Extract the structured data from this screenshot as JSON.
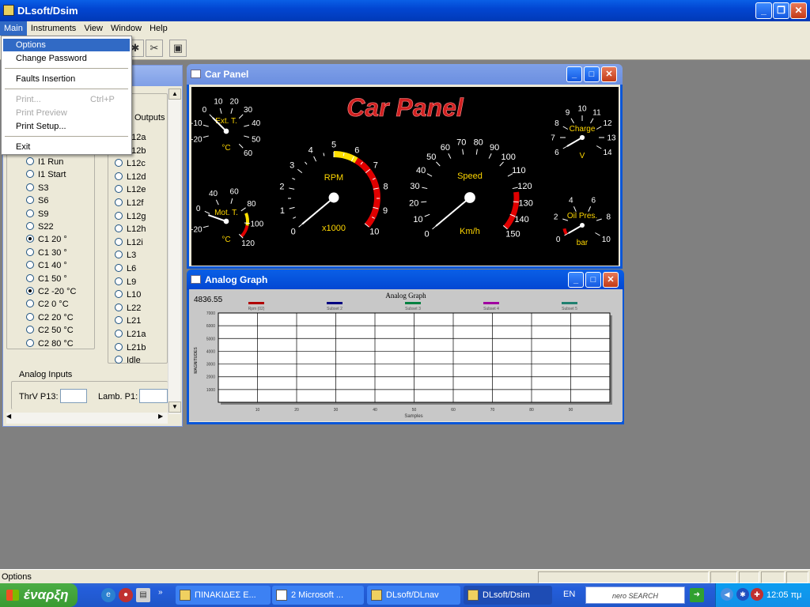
{
  "app": {
    "title": "DLsoft/Dsim"
  },
  "menubar": [
    "Main",
    "Instruments",
    "View",
    "Window",
    "Help"
  ],
  "main_menu": {
    "items": [
      {
        "label": "Options",
        "state": "selected"
      },
      {
        "label": "Change Password",
        "state": "normal"
      },
      {
        "label": "Faults Insertion",
        "state": "normal"
      },
      {
        "label": "Print...",
        "shortcut": "Ctrl+P",
        "state": "disabled"
      },
      {
        "label": "Print Preview",
        "state": "disabled"
      },
      {
        "label": "Print Setup...",
        "state": "normal"
      },
      {
        "label": "Exit",
        "state": "normal"
      }
    ]
  },
  "left_panel": {
    "inputs_col": [
      "I1 Run",
      "I1 Start",
      "S3",
      "S6",
      "S9",
      "S22",
      "C1  20 °",
      "C1  30 °",
      "C1  40 °",
      "C1  50 °",
      "C2 -20 °C",
      "C2   0 °C",
      "C2  20 °C",
      "C2  50 °C",
      "C2  80 °C"
    ],
    "inputs_checked": [
      6,
      10
    ],
    "outputs_label": "Outputs",
    "outputs_col": [
      "L12a",
      "L12b",
      "L12c",
      "L12d",
      "L12e",
      "L12f",
      "L12g",
      "L12h",
      "L12i",
      "L3",
      "L6",
      "L9",
      "L10",
      "L22",
      "L21",
      "L21a",
      "L21b",
      "Idle"
    ],
    "analog_inputs_label": "Analog Inputs",
    "thrv_label": "ThrV P13:",
    "lamb_label": "Lamb. P1:"
  },
  "car_panel": {
    "title": "Car Panel",
    "banner": "Car Panel",
    "ext_t": {
      "label": "Ext. T.",
      "unit": "°C",
      "ticks": [
        "-20",
        "-10",
        "0",
        "10",
        "20",
        "30",
        "40",
        "50",
        "60"
      ],
      "value": 0
    },
    "mot_t": {
      "label": "Mot. T.",
      "unit": "°C",
      "ticks": [
        "-20",
        "0",
        "40",
        "60",
        "80",
        "100",
        "120"
      ],
      "value": 0
    },
    "rpm": {
      "label": "RPM",
      "unit": "x1000",
      "ticks": [
        "0",
        "1",
        "2",
        "3",
        "4",
        "5",
        "6",
        "7",
        "8",
        "9",
        "10"
      ],
      "value": 0
    },
    "speed": {
      "label": "Speed",
      "unit": "Km/h",
      "ticks": [
        "0",
        "10",
        "20",
        "30",
        "40",
        "50",
        "60",
        "70",
        "80",
        "90",
        "100",
        "110",
        "120",
        "130",
        "140",
        "150"
      ],
      "value": 0
    },
    "charge": {
      "label": "Charge",
      "unit": "V",
      "ticks": [
        "6",
        "7",
        "8",
        "9",
        "10",
        "11",
        "12",
        "13",
        "14"
      ],
      "value": 6
    },
    "oil": {
      "label": "Oil Pres.",
      "unit": "bar",
      "ticks": [
        "0",
        "2",
        "4",
        "6",
        "8",
        "10"
      ],
      "value": 0
    }
  },
  "analog_graph": {
    "title": "Analog Graph",
    "readout": "4836.55",
    "chart_title": "Analog Graph",
    "legend": [
      {
        "name": "Rpm (02)",
        "color": "#b00000"
      },
      {
        "name": "Subset 2",
        "color": "#000080"
      },
      {
        "name": "Subset 3",
        "color": "#008040"
      },
      {
        "name": "Subset 4",
        "color": "#a000a0"
      },
      {
        "name": "Subset 5",
        "color": "#208070"
      }
    ],
    "ylabel": "MAGNITUDES",
    "xlabel": "Samples",
    "yticks": [
      "1000",
      "2000",
      "3000",
      "4000",
      "5000",
      "6000",
      "7000"
    ],
    "xticks": [
      "10",
      "20",
      "30",
      "40",
      "50",
      "60",
      "70",
      "80",
      "90"
    ]
  },
  "status": {
    "text": "Options"
  },
  "taskbar": {
    "start": "έναρξη",
    "tasks": [
      "ΠΙΝΑΚΙΔΕΣ Ε...",
      "2 Microsoft ...",
      "DLsoft/DLnav",
      "DLsoft/Dsim"
    ],
    "lang": "EN",
    "search": "nero SEARCH",
    "clock": "12:05 πμ"
  }
}
